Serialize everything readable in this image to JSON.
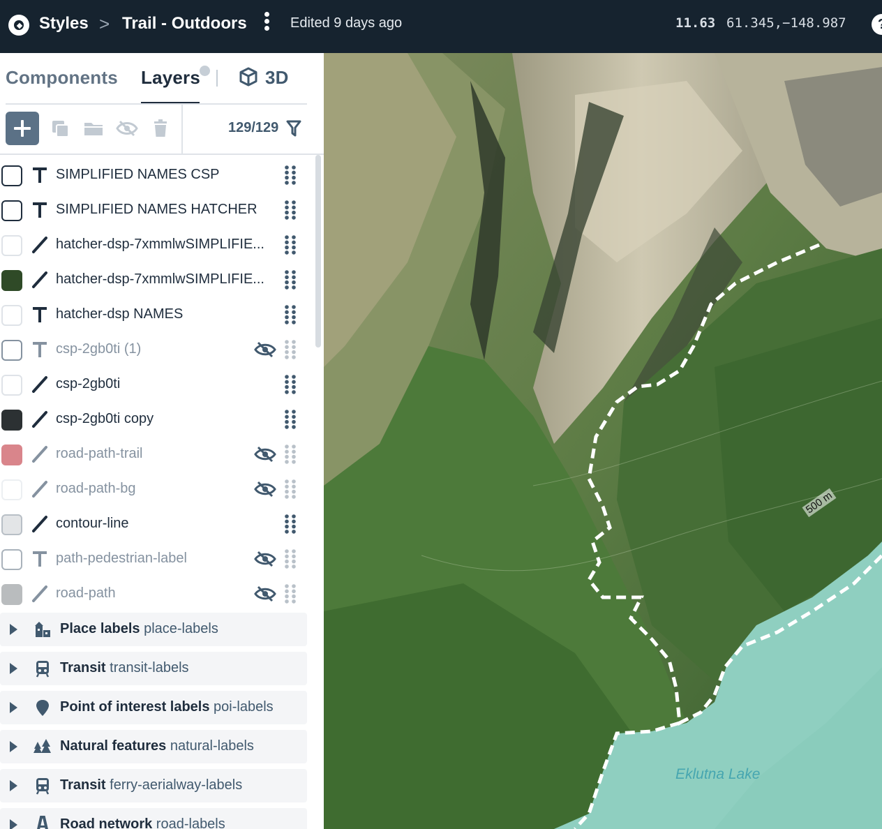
{
  "header": {
    "breadcrumb_root": "Styles",
    "breadcrumb_sep": ">",
    "style_name": "Trail - Outdoors",
    "edited": "Edited 9 days ago",
    "zoom": "11.63",
    "coordinates": "61.345,−148.987",
    "help": "?"
  },
  "tabs": {
    "components": "Components",
    "layers": "Layers",
    "three_d": "3D"
  },
  "toolbar": {
    "layer_count": "129/129"
  },
  "layers": [
    {
      "name": "SIMPLIFIED NAMES CSP",
      "type": "text",
      "swatch": "#ffffff",
      "swatch_border": "#1f2d3d",
      "hidden": false
    },
    {
      "name": "SIMPLIFIED NAMES HATCHER",
      "type": "text",
      "swatch": "#ffffff",
      "swatch_border": "#1f2d3d",
      "hidden": false
    },
    {
      "name": "hatcher-dsp-7xmmlwSIMPLIFIE...",
      "type": "line",
      "swatch": "#ffffff",
      "swatch_border": "#dfe3e8",
      "hidden": false
    },
    {
      "name": "hatcher-dsp-7xmmlwSIMPLIFIE...",
      "type": "line",
      "swatch": "#2f4a27",
      "swatch_border": "#2f4a27",
      "hidden": false
    },
    {
      "name": "hatcher-dsp NAMES",
      "type": "text",
      "swatch": "#ffffff",
      "swatch_border": "#dfe3e8",
      "hidden": false
    },
    {
      "name": "csp-2gb0ti (1)",
      "type": "text",
      "swatch": "#ffffff",
      "swatch_border": "#8592a0",
      "hidden": true
    },
    {
      "name": "csp-2gb0ti",
      "type": "line",
      "swatch": "#ffffff",
      "swatch_border": "#dfe3e8",
      "hidden": false
    },
    {
      "name": "csp-2gb0ti copy",
      "type": "line",
      "swatch": "#2c3133",
      "swatch_border": "#2c3133",
      "hidden": false
    },
    {
      "name": "road-path-trail",
      "type": "line",
      "swatch": "#d9858b",
      "swatch_border": "#d9858b",
      "hidden": true
    },
    {
      "name": "road-path-bg",
      "type": "line",
      "swatch": "#ffffff",
      "swatch_border": "#eceff2",
      "hidden": true
    },
    {
      "name": "contour-line",
      "type": "line",
      "swatch": "#e3e5e7",
      "swatch_border": "#b8bfc6",
      "hidden": false
    },
    {
      "name": "path-pedestrian-label",
      "type": "text",
      "swatch": "#ffffff",
      "swatch_border": "#a9b2bb",
      "hidden": true
    },
    {
      "name": "road-path",
      "type": "line",
      "swatch": "#b9bcbe",
      "swatch_border": "#b9bcbe",
      "hidden": true
    }
  ],
  "groups": [
    {
      "title": "Place labels",
      "id": "place-labels",
      "icon": "buildings-icon"
    },
    {
      "title": "Transit",
      "id": "transit-labels",
      "icon": "train-icon"
    },
    {
      "title": "Point of interest labels",
      "id": "poi-labels",
      "icon": "map-pin-icon"
    },
    {
      "title": "Natural features",
      "id": "natural-labels",
      "icon": "trees-icon"
    },
    {
      "title": "Transit",
      "id": "ferry-aerialway-labels",
      "icon": "train-icon"
    },
    {
      "title": "Road network",
      "id": "road-labels",
      "icon": "road-label-icon"
    }
  ],
  "map": {
    "lake_label": "Eklutna Lake",
    "contour_label": "500 m",
    "colors": {
      "forest": "#3f6a33",
      "lake": "#8fcfc0",
      "rock": "#b9b49c",
      "trail": "#ffffff"
    }
  }
}
